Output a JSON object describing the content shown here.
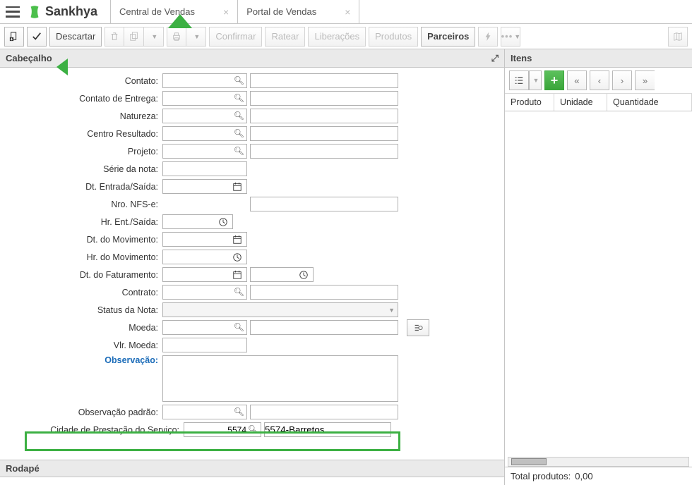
{
  "brand": "Sankhya",
  "tabs": [
    {
      "label": "Central de Vendas"
    },
    {
      "label": "Portal de Vendas"
    }
  ],
  "toolbar": {
    "descartar": "Descartar",
    "confirmar": "Confirmar",
    "ratear": "Ratear",
    "liberacoes": "Liberações",
    "produtos": "Produtos",
    "parceiros": "Parceiros"
  },
  "sections": {
    "cabecalho": "Cabeçalho",
    "rodape": "Rodapé",
    "itens": "Itens"
  },
  "form": {
    "contato": "Contato:",
    "contato_entrega": "Contato de Entrega:",
    "natureza": "Natureza:",
    "centro_resultado": "Centro Resultado:",
    "projeto": "Projeto:",
    "serie_nota": "Série da nota:",
    "dt_entrada_saida": "Dt. Entrada/Saída:",
    "nro_nfse": "Nro. NFS-e:",
    "hr_ent_saida": "Hr. Ent./Saída:",
    "dt_movimento": "Dt. do Movimento:",
    "hr_movimento": "Hr. do Movimento:",
    "dt_faturamento": "Dt. do Faturamento:",
    "contrato": "Contrato:",
    "status_nota": "Status da Nota:",
    "moeda": "Moeda:",
    "vlr_moeda": "Vlr. Moeda:",
    "observacao": "Observação:",
    "observacao_padrao": "Observação padrão:",
    "cidade_prestacao": "Cidade de Prestação do Serviço:",
    "cidade_value": "5574",
    "cidade_desc": "5574-Barretos"
  },
  "items": {
    "cols": {
      "produto": "Produto",
      "unidade": "Unidade",
      "quantidade": "Quantidade"
    },
    "total_label": "Total produtos:",
    "total_value": "0,00"
  }
}
